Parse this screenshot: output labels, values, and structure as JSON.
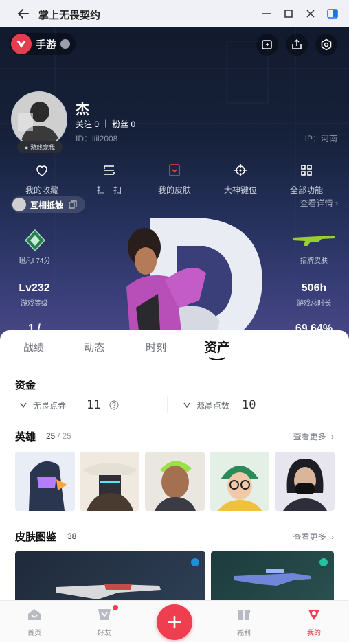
{
  "window": {
    "title": "掌上无畏契约"
  },
  "profile": {
    "mode_label": "手游",
    "avatar_tag": "● 游戏宠我",
    "username": "杰",
    "follow_label": "关注 0",
    "fans_label": "粉丝 0",
    "separator": "|",
    "id_text": "ID：liil2008",
    "ip_text": "IP：河南"
  },
  "quick_actions": [
    {
      "label": "我的收藏",
      "icon": "heart-icon"
    },
    {
      "label": "扫一扫",
      "icon": "scan-icon"
    },
    {
      "label": "我的皮肤",
      "icon": "skin-icon"
    },
    {
      "label": "大神键位",
      "icon": "crosshair-icon"
    },
    {
      "label": "全部功能",
      "icon": "grid-icon"
    }
  ],
  "interact": {
    "label": "互相抵触"
  },
  "detail_link": "查看详情 ›",
  "stats": {
    "rank_label": "超凡I 74分",
    "skin_label": "招牌皮肤",
    "level_value": "Lv232",
    "level_label": "游戏等级",
    "hours_value": "506h",
    "hours_label": "游戏总时长",
    "partial_left": "1 /",
    "partial_right": "69.64%"
  },
  "tabs": [
    {
      "label": "战绩"
    },
    {
      "label": "动态"
    },
    {
      "label": "时刻"
    },
    {
      "label": "资产"
    }
  ],
  "funds": {
    "title": "资金",
    "items": [
      {
        "label": "无畏点券",
        "value": "11"
      },
      {
        "label": "源晶点数",
        "value": "10"
      }
    ]
  },
  "heroes": {
    "title": "英雄",
    "owned": "25",
    "total": "/ 25",
    "more": "查看更多"
  },
  "skins": {
    "title": "皮肤图鉴",
    "count": "38",
    "more": "查看更多"
  },
  "nav": [
    {
      "label": "首页",
      "icon": "home-icon"
    },
    {
      "label": "好友",
      "icon": "friends-icon"
    },
    {
      "label": "福利",
      "icon": "gift-icon"
    },
    {
      "label": "我的",
      "icon": "profile-icon"
    }
  ],
  "colors": {
    "accent": "#ef3e4f",
    "hero_bg": "#16213a"
  }
}
